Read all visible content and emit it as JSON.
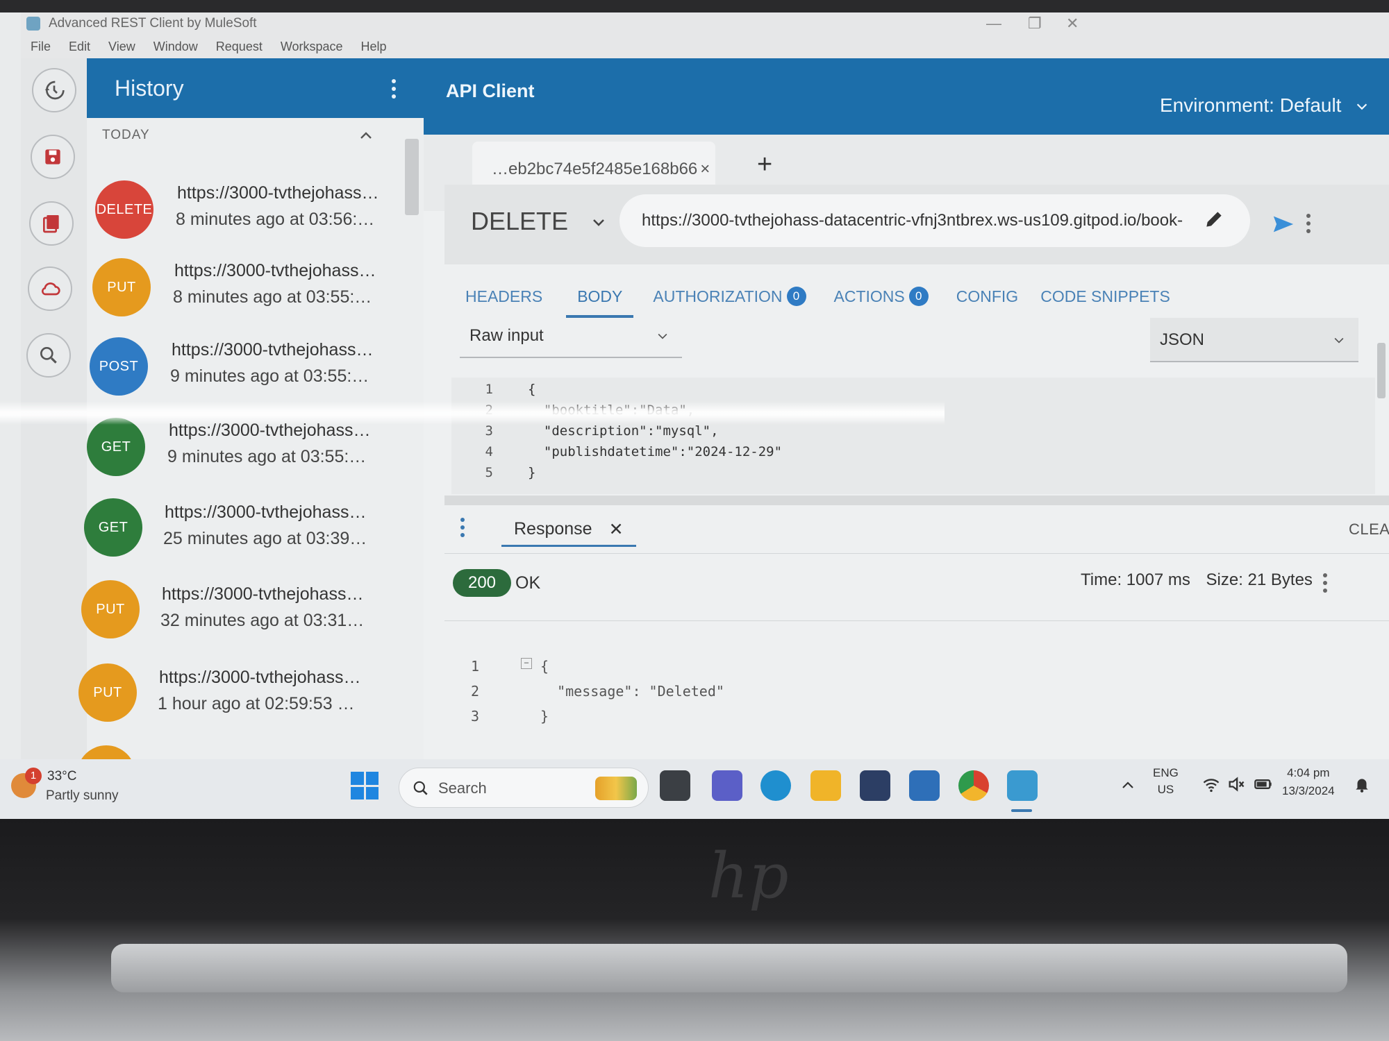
{
  "window": {
    "title": "Advanced REST Client by MuleSoft",
    "menu": [
      "File",
      "Edit",
      "View",
      "Window",
      "Request",
      "Workspace",
      "Help"
    ]
  },
  "rail": {
    "icons": [
      "history-icon",
      "save-icon",
      "saved-requests-icon",
      "cloud-icon",
      "search-icon"
    ]
  },
  "history": {
    "title": "History",
    "section": "TODAY",
    "items": [
      {
        "method": "DELETE",
        "color": "#d8453a",
        "url": "https://3000-tvthejohass…",
        "time": "8 minutes ago at 03:56:…"
      },
      {
        "method": "PUT",
        "color": "#e59a1e",
        "url": "https://3000-tvthejohass…",
        "time": "8 minutes ago at 03:55:…"
      },
      {
        "method": "POST",
        "color": "#2f7bc4",
        "url": "https://3000-tvthejohass…",
        "time": "9 minutes ago at 03:55:…"
      },
      {
        "method": "GET",
        "color": "#2e7d3c",
        "url": "https://3000-tvthejohass…",
        "time": "9 minutes ago at 03:55:…"
      },
      {
        "method": "GET",
        "color": "#2e7d3c",
        "url": "https://3000-tvthejohass…",
        "time": "25 minutes ago at 03:39…"
      },
      {
        "method": "PUT",
        "color": "#e59a1e",
        "url": "https://3000-tvthejohass…",
        "time": "32 minutes ago at 03:31…"
      },
      {
        "method": "PUT",
        "color": "#e59a1e",
        "url": "https://3000-tvthejohass…",
        "time": "1 hour ago at 02:59:53 …"
      }
    ]
  },
  "client": {
    "title": "API Client",
    "environment": "Environment: Default",
    "tab_label": "…eb2bc74e5f2485e168b66",
    "tab_close": "×",
    "add_tab": "+",
    "method": "DELETE",
    "url": "https://3000-tvthejohass-datacentric-vfnj3ntbrex.ws-us109.gitpod.io/book-",
    "subtabs": {
      "headers": "HEADERS",
      "body": "BODY",
      "authorization": "AUTHORIZATION",
      "authorization_count": "0",
      "actions": "ACTIONS",
      "actions_count": "0",
      "config": "CONFIG",
      "code_snippets": "CODE SNIPPETS"
    },
    "body_type": "Raw input",
    "content_type": "JSON",
    "body_lines": [
      {
        "n": "1",
        "text": "{"
      },
      {
        "n": "2",
        "text": "  \"booktitle\":\"Data\","
      },
      {
        "n": "3",
        "text": "  \"description\":\"mysql\","
      },
      {
        "n": "4",
        "text": "  \"publishdatetime\":\"2024-12-29\""
      },
      {
        "n": "5",
        "text": "}"
      }
    ]
  },
  "response": {
    "tab_label": "Response",
    "tab_close": "✕",
    "clear": "CLEAR",
    "status_code": "200",
    "status_text": "OK",
    "time": "Time: 1007 ms",
    "size": "Size: 21 Bytes",
    "lines": [
      {
        "n": "1",
        "text": "{"
      },
      {
        "n": "2",
        "text": "  \"message\": \"Deleted\""
      },
      {
        "n": "3",
        "text": "}"
      }
    ]
  },
  "taskbar": {
    "temperature": "33°C",
    "condition": "Partly sunny",
    "weather_badge": "1",
    "search_label": "Search",
    "lang_top": "ENG",
    "lang_bottom": "US",
    "clock_time": "4:04 pm",
    "clock_date": "13/3/2024"
  },
  "colors": {
    "header_blue": "#1c6eaa",
    "accent_blue": "#3a78b0",
    "status_green": "#2c6b3c"
  }
}
